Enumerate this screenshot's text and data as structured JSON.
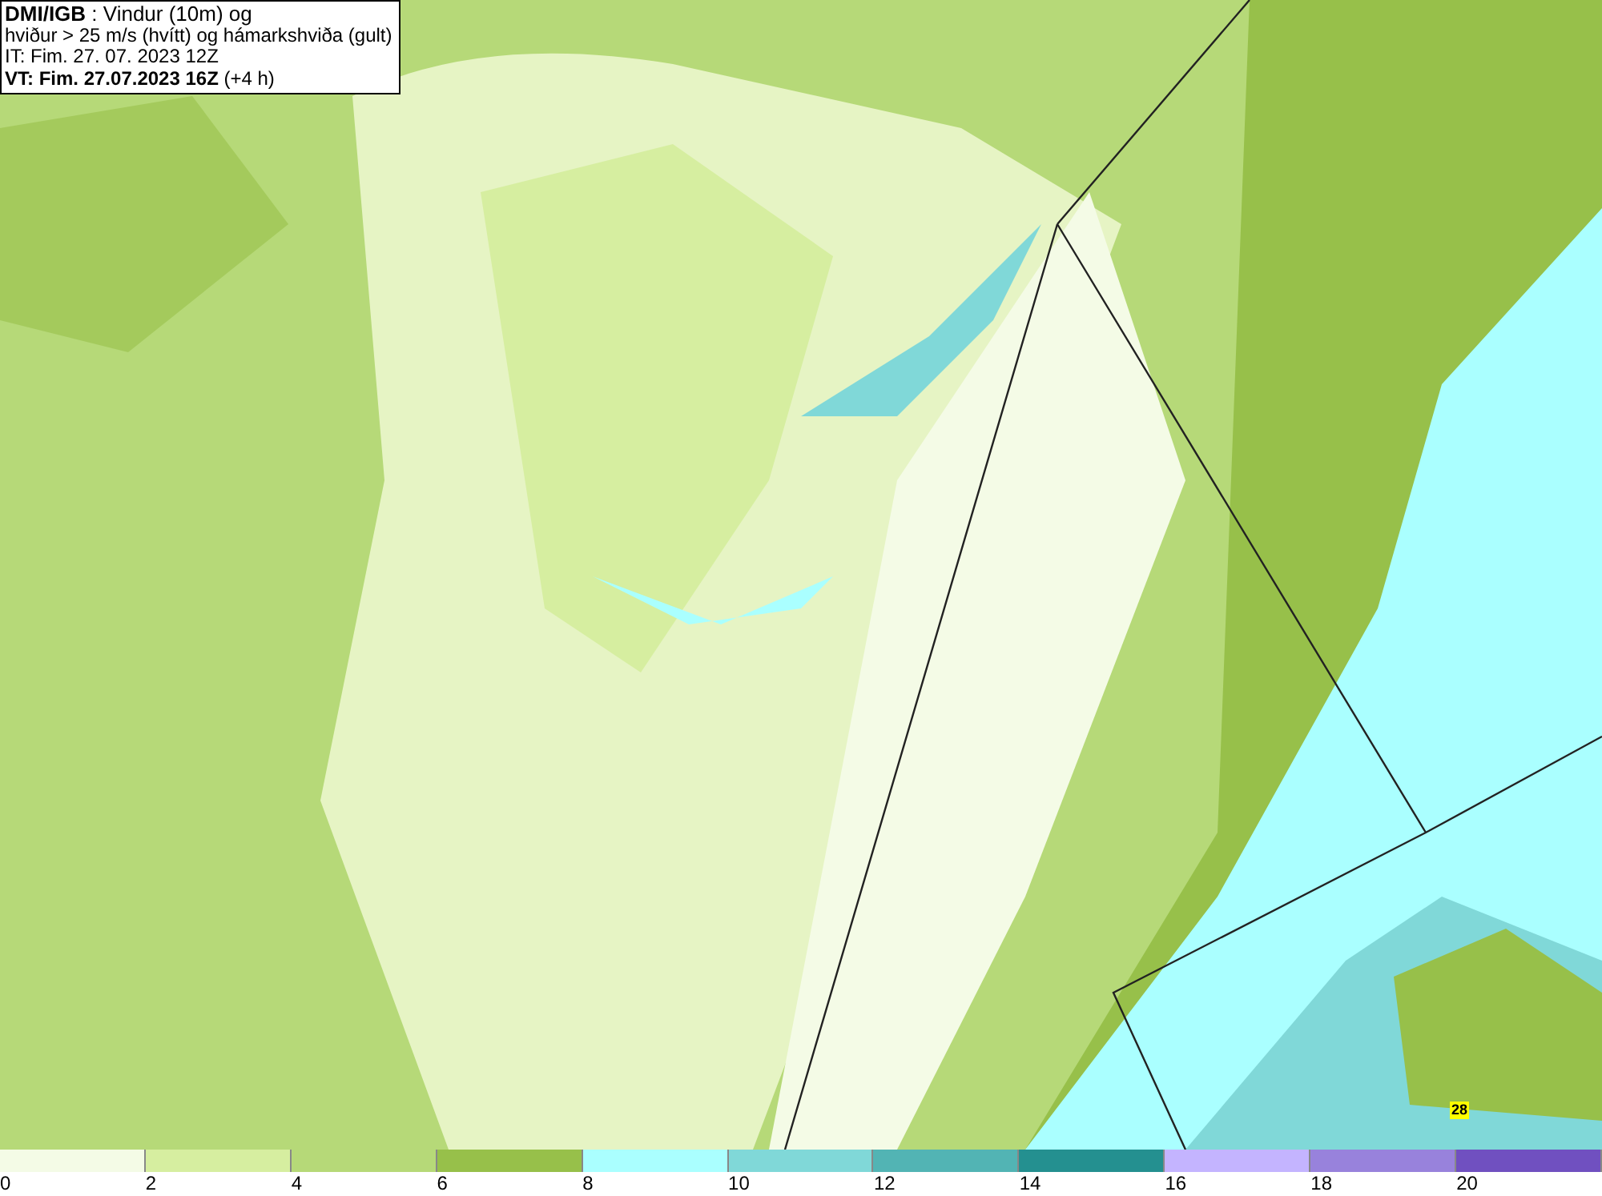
{
  "header": {
    "lines": [
      "**DMI/IGB** : Vindur (10m) og",
      "hviður > 25 m/s (hvítt) og hámarkshviða (gult)",
      "IT: Fim. 27. 07. 2023 12Z",
      "**VT: Fim. 27.07.2023 16Z** (+4 h)"
    ]
  },
  "map": {
    "gust_max_label": "28"
  },
  "legend": [
    {
      "color": "#f4fbe6",
      "label": "0"
    },
    {
      "color": "#d6eea0",
      "label": "2"
    },
    {
      "color": "#b6d978",
      "label": "4"
    },
    {
      "color": "#97c04a",
      "label": "6"
    },
    {
      "color": "#aaffff",
      "label": "8"
    },
    {
      "color": "#80d8d8",
      "label": "10"
    },
    {
      "color": "#52b4b4",
      "label": "12"
    },
    {
      "color": "#249090",
      "label": "14"
    },
    {
      "color": "#c4b4ff",
      "label": "16"
    },
    {
      "color": "#9882dc",
      "label": "18"
    },
    {
      "color": "#7050c0",
      "label": "20"
    }
  ]
}
